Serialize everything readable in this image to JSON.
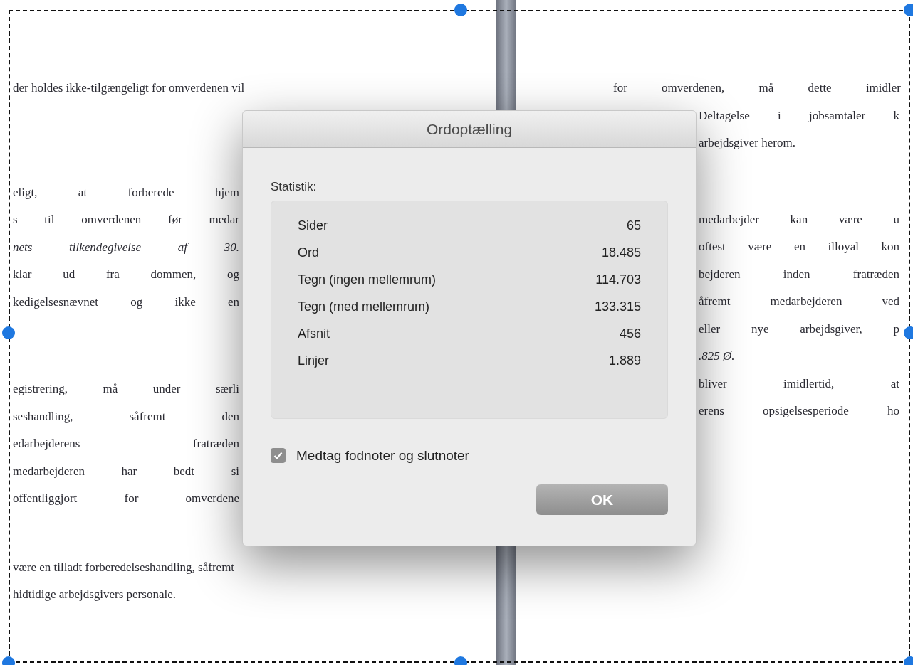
{
  "document": {
    "left_page": [
      [
        {
          "text": "der holdes ikke-tilgængeligt for omverdenen vil",
          "kind": "plain"
        }
      ],
      [
        {
          "text": "eligt, at forberede hjem",
          "kind": "justified"
        },
        {
          "text": "s til omverdenen før medar",
          "kind": "justified"
        },
        {
          "text": "nets tilkendegivelse af 30.",
          "kind": "justified",
          "italic": true
        },
        {
          "text": "klar ud fra dommen, og",
          "kind": "justified"
        },
        {
          "text": "kedigelsesnævnet og ikke en",
          "kind": "justified"
        }
      ],
      [
        {
          "text": "egistrering, må under særli",
          "kind": "justified"
        },
        {
          "text": "seshandling, såfremt den",
          "kind": "justified"
        },
        {
          "text": "edarbejderens fratræden",
          "kind": "justified"
        },
        {
          "text": "medarbejderen har bedt si",
          "kind": "justified"
        },
        {
          "text": "offentliggjort for omverdene",
          "kind": "justified"
        }
      ],
      [
        {
          "text": "være en tilladt forberedelseshandling, såfremt",
          "kind": "plain"
        },
        {
          "text": "hidtidige arbejdsgivers personale.",
          "kind": "plain"
        }
      ]
    ],
    "right_page": [
      [
        {
          "text": "for omverdenen, må dette imidler",
          "kind": "justified"
        },
        {
          "text": "Deltagelse i jobsamtaler k",
          "kind": "justified"
        },
        {
          "text": "arbejdsgiver herom.",
          "kind": "plain"
        }
      ],
      [
        {
          "text": "medarbejder kan være u",
          "kind": "justified"
        },
        {
          "text": "oftest være en illoyal kon",
          "kind": "justified"
        },
        {
          "text": "bejderen inden fratræden",
          "kind": "justified"
        },
        {
          "text": "åfremt medarbejderen ved",
          "kind": "justified"
        },
        {
          "text": "eller nye arbejdsgiver, p",
          "kind": "justified"
        },
        {
          "text": ".825 Ø.",
          "kind": "plain",
          "italic": true
        },
        {
          "text": "bliver imidlertid, at",
          "kind": "justified"
        },
        {
          "text": "erens opsigelsesperiode ho",
          "kind": "justified"
        }
      ]
    ]
  },
  "dialog": {
    "title": "Ordoptælling",
    "section_label": "Statistik:",
    "stats": [
      {
        "label": "Sider",
        "value": "65"
      },
      {
        "label": "Ord",
        "value": "18.485"
      },
      {
        "label": "Tegn (ingen mellemrum)",
        "value": "114.703"
      },
      {
        "label": "Tegn (med mellemrum)",
        "value": "133.315"
      },
      {
        "label": "Afsnit",
        "value": "456"
      },
      {
        "label": "Linjer",
        "value": "1.889"
      }
    ],
    "checkbox": {
      "label": "Medtag fodnoter og slutnoter",
      "checked": true
    },
    "button": "OK"
  }
}
